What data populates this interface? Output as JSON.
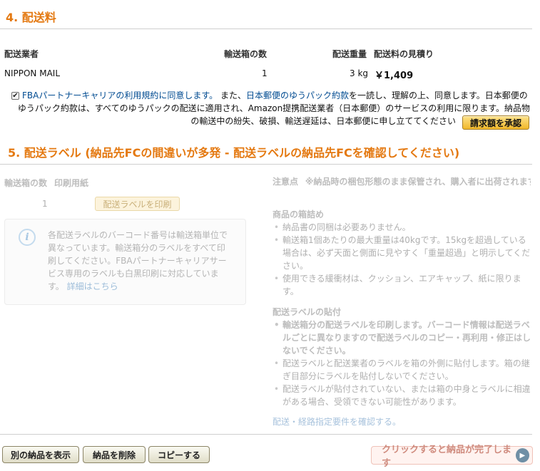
{
  "shipping_fee": {
    "section_title": "4. 配送料",
    "headers": {
      "carrier": "配送業者",
      "boxes": "輸送箱の数",
      "weight": "配送重量",
      "estimate": "配送料の見積り"
    },
    "row": {
      "carrier": "NIPPON MAIL",
      "boxes": "1",
      "weight": "3 kg",
      "estimate": "￥1,409"
    },
    "agree": {
      "checked": true,
      "text_a": "FBAパートナーキャリアの利用規約に同意します。",
      "text_b": " また、",
      "text_c": "日本郵便のゆうパック約款",
      "text_d": "を一読し、理解の上、同意します。日本郵便の",
      "line2": "ゆうパック約款は、すべてのゆうパックの配送に適用され、Amazon提携配送業者（日本郵便）のサービスの利用に限ります。納品物",
      "line3": "の輸送中の紛失、破損、輸送遅延は、日本郵便に申し立ててください",
      "approve_button": "請求額を承認"
    }
  },
  "shipping_label": {
    "section_title": "5. 配送ラベル (納品先FCの間違いが多発 - 配送ラベルの納品先FCを確認してください)",
    "left": {
      "col_boxes": "輸送箱の数",
      "col_paper": "印刷用紙",
      "boxes_value": "1",
      "print_button": "配送ラベルを印刷",
      "info_lines": [
        "各配送ラベルのバーコード番号は輸送箱単位で",
        "異なっています。輸送箱分のラベルをすべて印",
        "刷してください。FBAパートナーキャリアサー",
        "ビス専用のラベルも白黒印刷に対応していま"
      ],
      "info_last": "す。",
      "info_link": "詳細はこちら"
    },
    "right": {
      "caution_label": "注意点",
      "caution_text": "※納品時の梱包形態のまま保管され、購入者に出荷されます",
      "packing_heading": "商品の箱詰め",
      "packing_items": [
        "納品書の同梱は必要ありません。",
        "輸送箱1個あたりの最大重量は40kgです。15kgを超過している場合は、必ず天面と側面に見やすく「重量超過」と明示してください。",
        "使用できる緩衝材は、クッション、エアキャップ、紙に限ります。"
      ],
      "label_heading": "配送ラベルの貼付",
      "label_items_bold": "輸送箱分の配送ラベルを印刷します。バーコード情報は配送ラベルごとに異なりますので配送ラベルのコピー・再利用・修正はしないでください。",
      "label_items": [
        "配送ラベルと配送業者のラベルを箱の外側に貼付します。箱の継ぎ目部分にラベルを貼付しないでください。",
        "配送ラベルが貼付されていない、または箱の中身とラベルに相違がある場合、受領できない可能性があります。"
      ],
      "requirements_link": "配送・経路指定要件を確認する。"
    }
  },
  "footer": {
    "show_other": "別の納品を表示",
    "delete": "納品を削除",
    "copy": "コピーする",
    "complete": "クリックすると納品が完了します"
  }
}
